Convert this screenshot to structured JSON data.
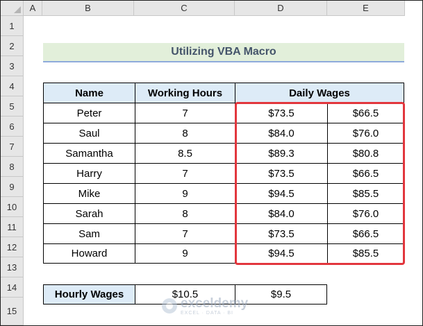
{
  "columns": [
    "A",
    "B",
    "C",
    "D",
    "E"
  ],
  "rows": [
    "1",
    "2",
    "3",
    "4",
    "5",
    "6",
    "7",
    "8",
    "9",
    "10",
    "11",
    "12",
    "13",
    "14",
    "15"
  ],
  "title": "Utilizing  VBA Macro",
  "table": {
    "headers": {
      "name": "Name",
      "hours": "Working Hours",
      "wages": "Daily Wages"
    },
    "data": [
      {
        "name": "Peter",
        "hours": "7",
        "wage1": "$73.5",
        "wage2": "$66.5"
      },
      {
        "name": "Saul",
        "hours": "8",
        "wage1": "$84.0",
        "wage2": "$76.0"
      },
      {
        "name": "Samantha",
        "hours": "8.5",
        "wage1": "$89.3",
        "wage2": "$80.8"
      },
      {
        "name": "Harry",
        "hours": "7",
        "wage1": "$73.5",
        "wage2": "$66.5"
      },
      {
        "name": "Mike",
        "hours": "9",
        "wage1": "$94.5",
        "wage2": "$85.5"
      },
      {
        "name": "Sarah",
        "hours": "8",
        "wage1": "$84.0",
        "wage2": "$76.0"
      },
      {
        "name": "Sam",
        "hours": "7",
        "wage1": "$73.5",
        "wage2": "$66.5"
      },
      {
        "name": "Howard",
        "hours": "9",
        "wage1": "$94.5",
        "wage2": "$85.5"
      }
    ]
  },
  "hourly": {
    "label": "Hourly Wages",
    "rate1": "$10.5",
    "rate2": "$9.5"
  },
  "watermark": {
    "name": "exceldemy",
    "tagline": "EXCEL · DATA · BI"
  },
  "colors": {
    "title_bg": "#e2efda",
    "title_text": "#44546a",
    "header_bg": "#ddebf7",
    "highlight": "#e2363d"
  }
}
